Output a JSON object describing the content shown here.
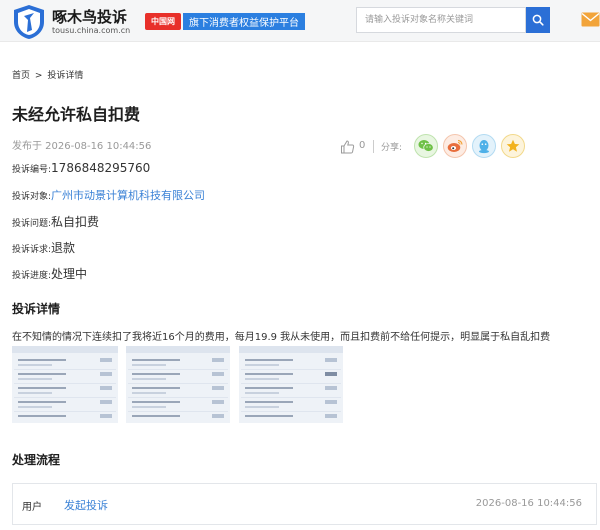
{
  "header": {
    "logo_title": "啄木鸟投诉",
    "logo_url": "tousu.china.com.cn",
    "partner_badge": "中国网",
    "partner_text": "旗下消费者权益保护平台",
    "search_placeholder": "请输入投诉对象名称关键词",
    "search_icon": "search-icon",
    "mail_icon": "mail-icon"
  },
  "breadcrumb": {
    "home": "首页",
    "separator": ">",
    "current": "投诉详情"
  },
  "complaint": {
    "title": "未经允许私自扣费",
    "publish_time": "发布于 2026-08-16 10:44:56",
    "like_count": "0",
    "share_label": "分享:",
    "fields": [
      {
        "label": "投诉编号:",
        "value": "1786848295760",
        "is_link": false
      },
      {
        "label": "投诉对象:",
        "value": "广州市动景计算机科技有限公司",
        "is_link": true
      },
      {
        "label": "投诉问题:",
        "value": "私自扣费",
        "is_link": false
      },
      {
        "label": "投诉诉求:",
        "value": "退款",
        "is_link": false
      },
      {
        "label": "投诉进度:",
        "value": "处理中",
        "is_link": false
      }
    ]
  },
  "details": {
    "section_title": "投诉详情",
    "text": "在不知情的情况下连续扣了我将近16个月的费用，每月19.9 我从未使用，而且扣费前不给任何提示，明显属于私自乱扣费"
  },
  "flow": {
    "section_title": "处理流程",
    "user": "用户",
    "action": "发起投诉",
    "time": "2026-08-16 10:44:56"
  },
  "colors": {
    "brand_blue": "#2b6fd6",
    "link_blue": "#3b82d6",
    "wechat_green": "#6ec046",
    "weibo_orange": "#e86e3c",
    "qq_blue": "#4eb0e8",
    "qzone_yellow": "#f2b21d"
  }
}
